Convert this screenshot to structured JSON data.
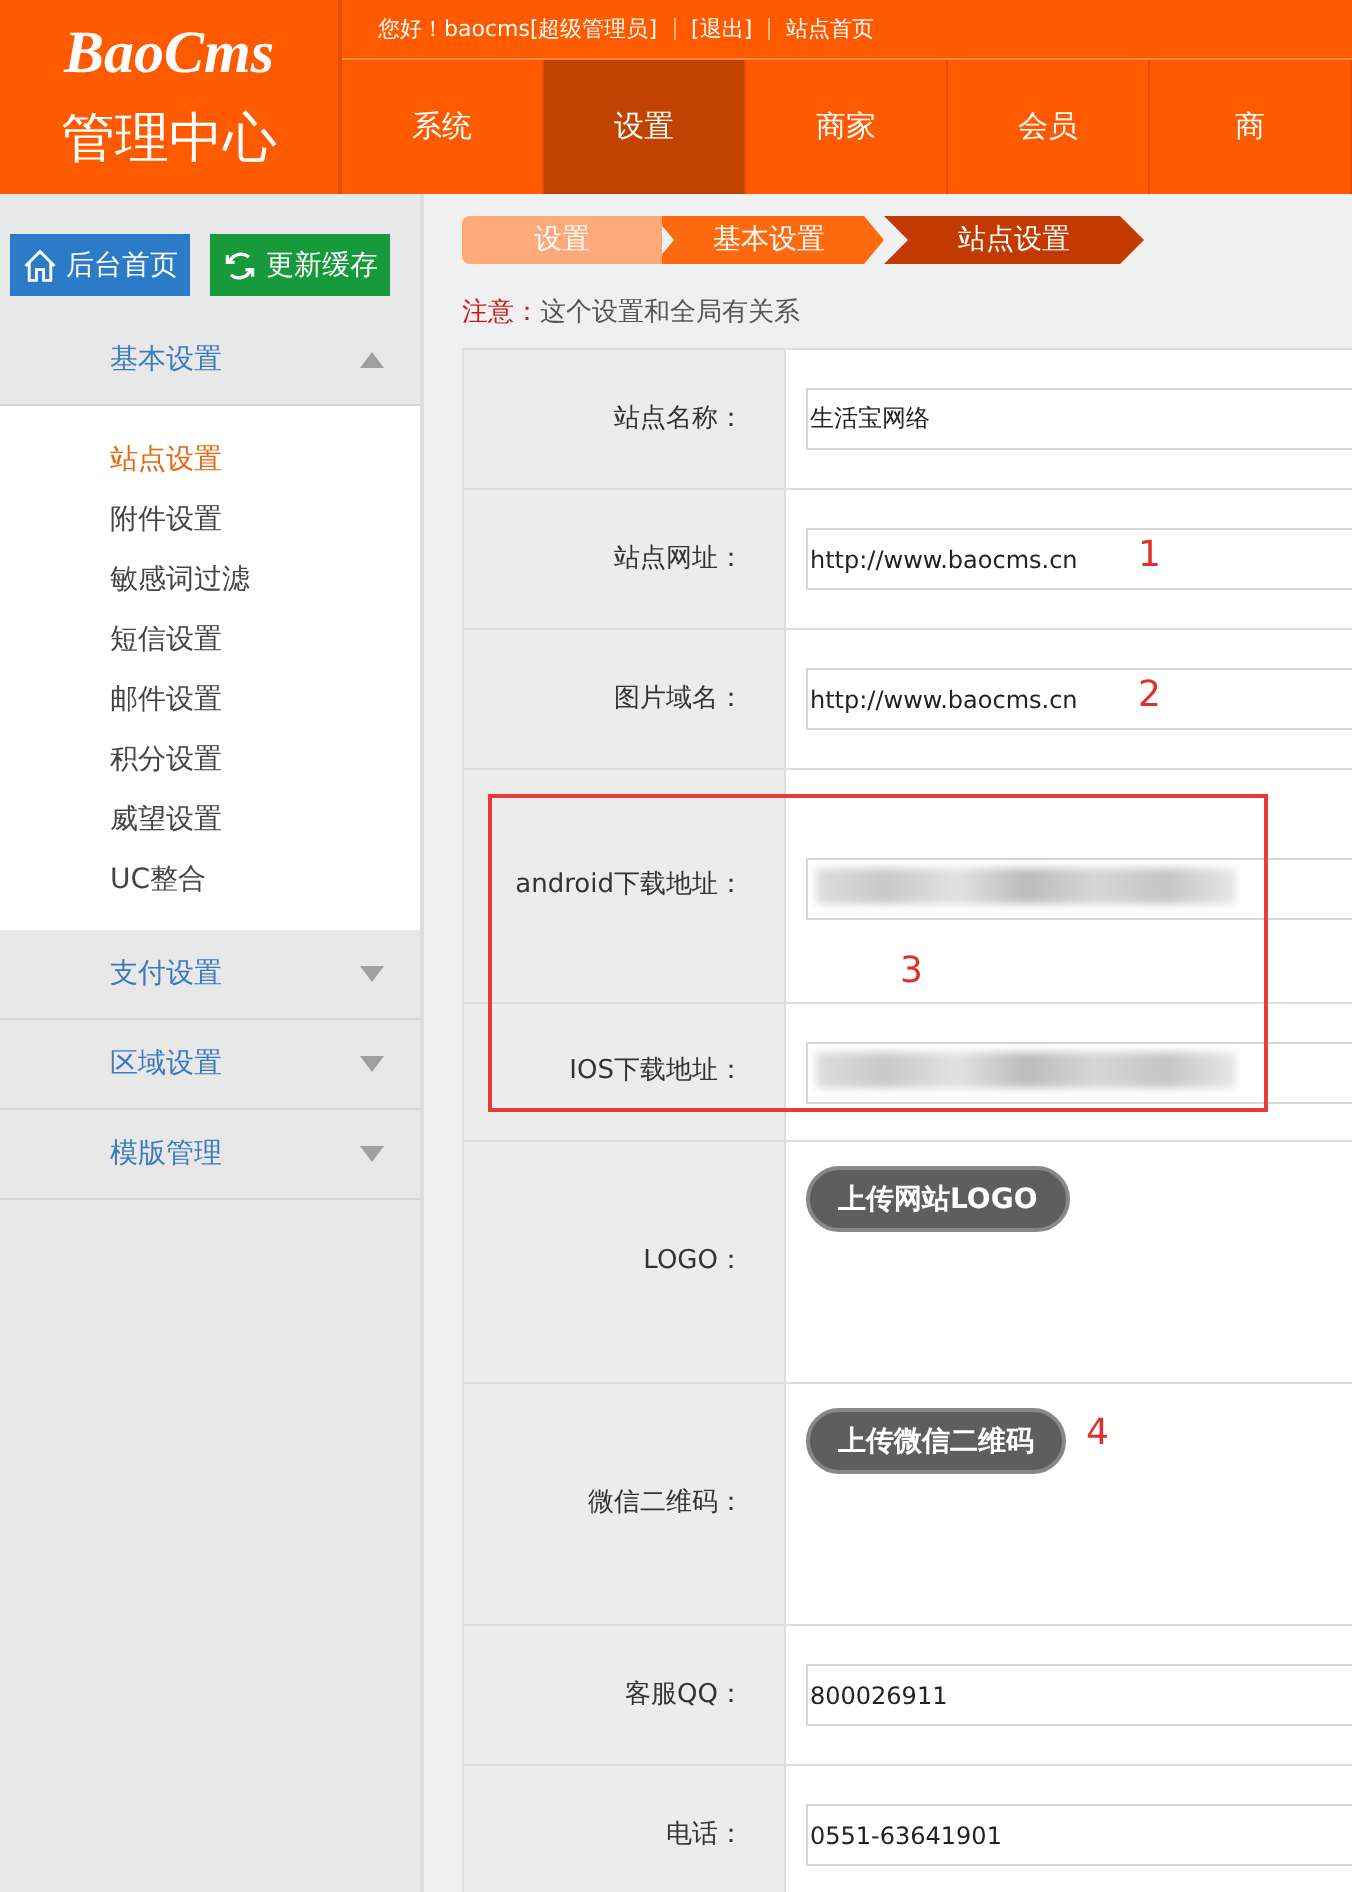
{
  "brand": {
    "logo": "BaoCms",
    "subtitle": "管理中心"
  },
  "topbar": {
    "greeting": "您好！baocms[超级管理员]",
    "links": [
      "[退出]",
      "站点首页"
    ]
  },
  "nav": [
    {
      "label": "系统",
      "selected": false
    },
    {
      "label": "设置",
      "selected": true
    },
    {
      "label": "商家",
      "selected": false
    },
    {
      "label": "会员",
      "selected": false
    },
    {
      "label": "商",
      "selected": false
    }
  ],
  "quick_buttons": [
    {
      "kind": "home",
      "label": "后台首页"
    },
    {
      "kind": "refresh",
      "label": "更新缓存"
    }
  ],
  "sidebar": [
    {
      "label": "基本设置",
      "expanded": true,
      "children": [
        {
          "label": "站点设置",
          "selected": true
        },
        {
          "label": "附件设置",
          "selected": false
        },
        {
          "label": "敏感词过滤",
          "selected": false
        },
        {
          "label": "短信设置",
          "selected": false
        },
        {
          "label": "邮件设置",
          "selected": false
        },
        {
          "label": "积分设置",
          "selected": false
        },
        {
          "label": "威望设置",
          "selected": false
        },
        {
          "label": "UC整合",
          "selected": false
        }
      ]
    },
    {
      "label": "支付设置",
      "expanded": false
    },
    {
      "label": "区域设置",
      "expanded": false
    },
    {
      "label": "模版管理",
      "expanded": false
    }
  ],
  "breadcrumb": [
    "设置",
    "基本设置",
    "站点设置"
  ],
  "notice": {
    "label": "注意：",
    "text": "这个设置和全局有关系"
  },
  "form": {
    "rows": [
      {
        "kind": "input",
        "label": "站点名称：",
        "value": "生活宝网络"
      },
      {
        "kind": "input",
        "label": "站点网址：",
        "value": "http://www.baocms.cn",
        "annotation": "1"
      },
      {
        "kind": "input",
        "label": "图片域名：",
        "value": "http://www.baocms.cn",
        "annotation": "2"
      },
      {
        "kind": "blurred",
        "label": "android下载地址："
      },
      {
        "kind": "blurred",
        "label": "IOS下载地址："
      },
      {
        "kind": "upload",
        "label": "LOGO：",
        "button": "上传网站LOGO"
      },
      {
        "kind": "upload",
        "label": "微信二维码：",
        "button": "上传微信二维码",
        "annotation": "4"
      },
      {
        "kind": "input",
        "label": "客服QQ：",
        "value": "800026911"
      },
      {
        "kind": "input",
        "label": "电话：",
        "value": "0551-63641901"
      }
    ],
    "highlight": {
      "label": "3"
    }
  }
}
